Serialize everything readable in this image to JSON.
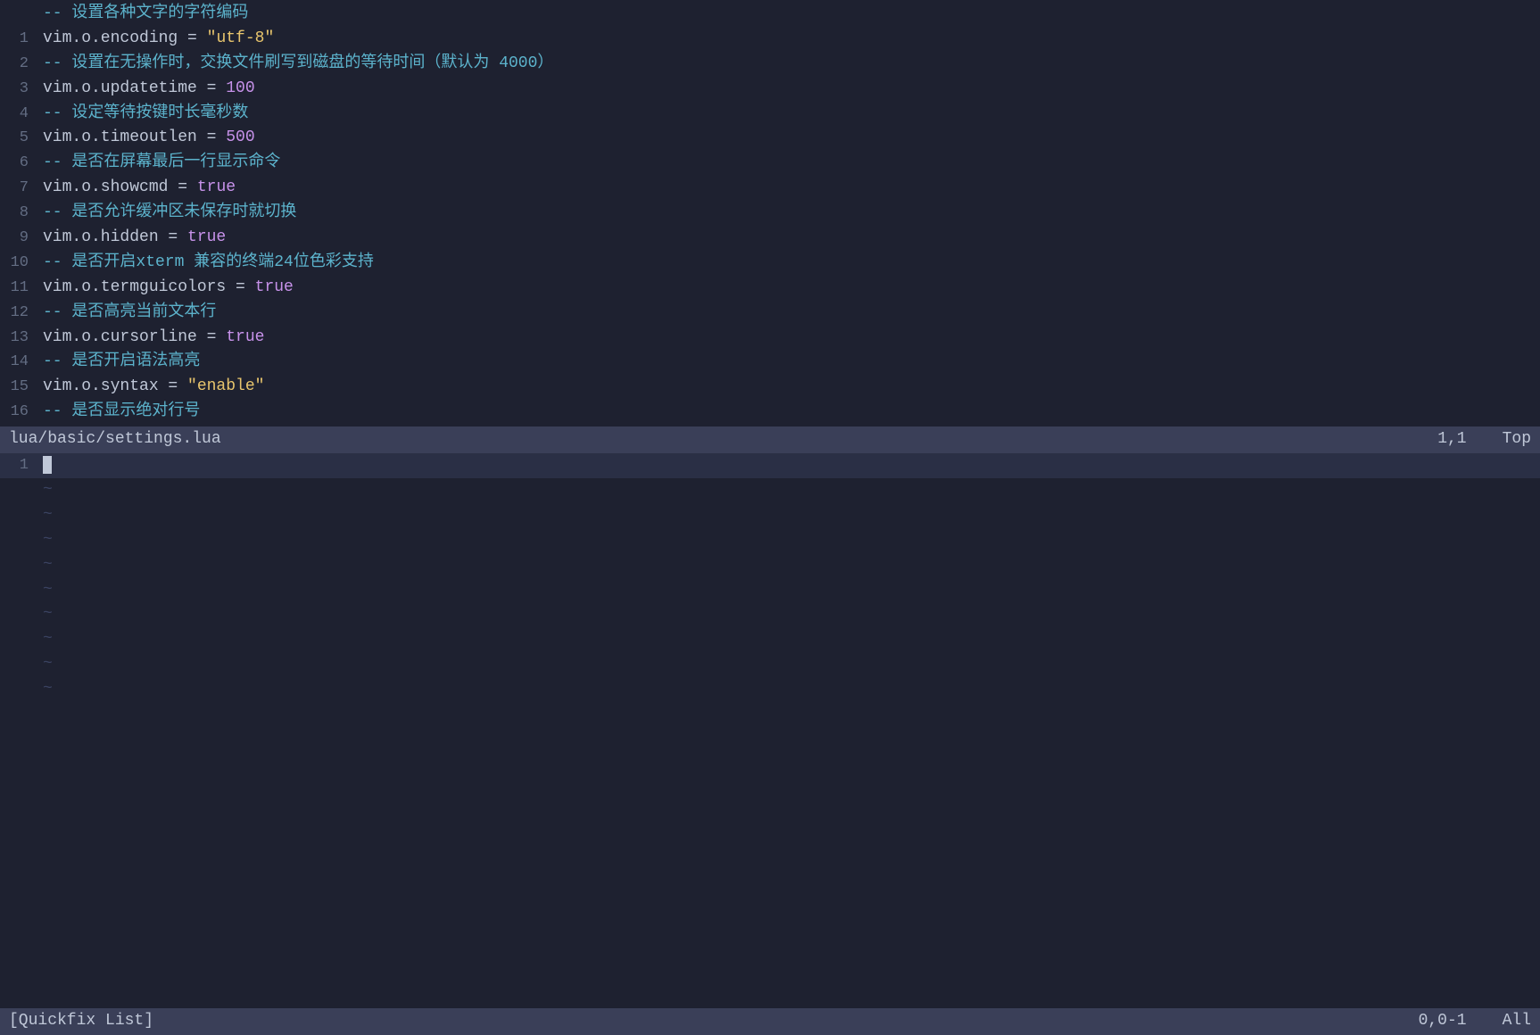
{
  "editor": {
    "top_pane": {
      "lines": [
        {
          "num": "",
          "parts": [
            {
              "type": "comment",
              "text": "-- 设置各种文字的字符编码"
            }
          ]
        },
        {
          "num": "1",
          "parts": [
            {
              "type": "key",
              "text": "vim.o.encoding"
            },
            {
              "type": "equals",
              "text": " = "
            },
            {
              "type": "string",
              "text": "\"utf-8\""
            }
          ]
        },
        {
          "num": "2",
          "parts": [
            {
              "type": "comment",
              "text": "-- 设置在无操作时，交换文件刷写到磁盘的等待时间（默认为 4000）"
            }
          ]
        },
        {
          "num": "3",
          "parts": [
            {
              "type": "key",
              "text": "vim.o.updatetime"
            },
            {
              "type": "equals",
              "text": " = "
            },
            {
              "type": "num",
              "text": "100"
            }
          ]
        },
        {
          "num": "4",
          "parts": [
            {
              "type": "comment",
              "text": "-- 设定等待按键时长毫秒数"
            }
          ]
        },
        {
          "num": "5",
          "parts": [
            {
              "type": "key",
              "text": "vim.o.timeoutlen"
            },
            {
              "type": "equals",
              "text": " = "
            },
            {
              "type": "num",
              "text": "500"
            }
          ]
        },
        {
          "num": "6",
          "parts": [
            {
              "type": "comment",
              "text": "-- 是否在屏幕最后一行显示命令"
            }
          ]
        },
        {
          "num": "7",
          "parts": [
            {
              "type": "key",
              "text": "vim.o.showcmd"
            },
            {
              "type": "equals",
              "text": " = "
            },
            {
              "type": "bool",
              "text": "true"
            }
          ]
        },
        {
          "num": "8",
          "parts": [
            {
              "type": "comment",
              "text": "-- 是否允许缓冲区未保存时就切换"
            }
          ]
        },
        {
          "num": "9",
          "parts": [
            {
              "type": "key",
              "text": "vim.o.hidden"
            },
            {
              "type": "equals",
              "text": " = "
            },
            {
              "type": "bool",
              "text": "true"
            }
          ]
        },
        {
          "num": "10",
          "parts": [
            {
              "type": "comment",
              "text": "-- 是否开启xterm 兼容的终端24位色彩支持"
            }
          ]
        },
        {
          "num": "11",
          "parts": [
            {
              "type": "key",
              "text": "vim.o.termguicolors"
            },
            {
              "type": "equals",
              "text": " = "
            },
            {
              "type": "bool",
              "text": "true"
            }
          ]
        },
        {
          "num": "12",
          "parts": [
            {
              "type": "comment",
              "text": "-- 是否高亮当前文本行"
            }
          ]
        },
        {
          "num": "13",
          "parts": [
            {
              "type": "key",
              "text": "vim.o.cursorline"
            },
            {
              "type": "equals",
              "text": " = "
            },
            {
              "type": "bool",
              "text": "true"
            }
          ]
        },
        {
          "num": "14",
          "parts": [
            {
              "type": "comment",
              "text": "-- 是否开启语法高亮"
            }
          ]
        },
        {
          "num": "15",
          "parts": [
            {
              "type": "key",
              "text": "vim.o.syntax"
            },
            {
              "type": "equals",
              "text": " = "
            },
            {
              "type": "string",
              "text": "\"enable\""
            }
          ]
        },
        {
          "num": "16",
          "parts": [
            {
              "type": "comment",
              "text": "-- 是否显示绝对行号"
            }
          ]
        }
      ],
      "status": {
        "filename": "lua/basic/settings.lua",
        "position": "1,1",
        "scroll": "Top"
      }
    },
    "bottom_pane": {
      "cursor_line_num": "1",
      "tildes": 9,
      "status": {
        "name": "[Quickfix List]",
        "position": "0,0-1",
        "scroll": "All"
      }
    }
  }
}
